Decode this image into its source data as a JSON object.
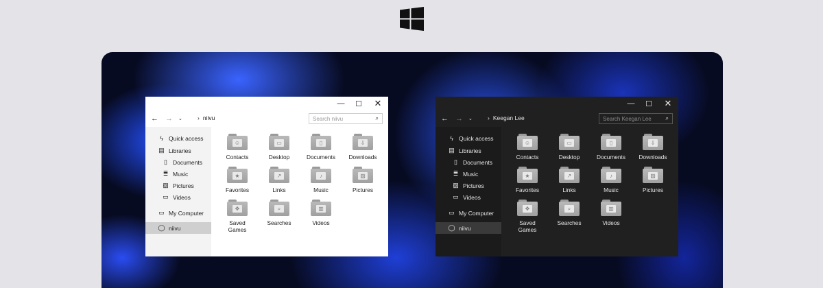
{
  "logo": {
    "icon": "windows-logo-icon"
  },
  "windows": [
    {
      "theme": "light",
      "controls": {
        "minimize": "—",
        "maximize": "☐",
        "close": "✕"
      },
      "nav": {
        "back": "←",
        "forward": "→",
        "recent": "⌄"
      },
      "breadcrumb": {
        "separator": "›",
        "location": "niivu"
      },
      "search": {
        "placeholder": "Search niivu",
        "icon": "⌕"
      },
      "sidebar": [
        {
          "label": "Quick access",
          "icon": "lightning-icon",
          "glyph": "ϟ"
        },
        {
          "label": "Libraries",
          "icon": "libraries-icon",
          "glyph": "▤"
        },
        {
          "label": "Documents",
          "icon": "document-icon",
          "glyph": "▯"
        },
        {
          "label": "Music",
          "icon": "music-icon",
          "glyph": "≣"
        },
        {
          "label": "Pictures",
          "icon": "pictures-icon",
          "glyph": "▨"
        },
        {
          "label": "Videos",
          "icon": "videos-icon",
          "glyph": "▭"
        },
        {
          "label": "My Computer",
          "icon": "computer-icon",
          "glyph": "▭"
        },
        {
          "label": "niivu",
          "icon": "user-icon",
          "glyph": "◯"
        }
      ],
      "folders": [
        {
          "label": "Contacts",
          "icon": "contacts-folder-icon",
          "glyph": "☺"
        },
        {
          "label": "Desktop",
          "icon": "desktop-folder-icon",
          "glyph": "▭"
        },
        {
          "label": "Documents",
          "icon": "documents-folder-icon",
          "glyph": "▯"
        },
        {
          "label": "Downloads",
          "icon": "downloads-folder-icon",
          "glyph": "⇩"
        },
        {
          "label": "Favorites",
          "icon": "favorites-folder-icon",
          "glyph": "★"
        },
        {
          "label": "Links",
          "icon": "links-folder-icon",
          "glyph": "↗"
        },
        {
          "label": "Music",
          "icon": "music-folder-icon",
          "glyph": "♪"
        },
        {
          "label": "Pictures",
          "icon": "pictures-folder-icon",
          "glyph": "▨"
        },
        {
          "label": "Saved Games",
          "icon": "saved-games-folder-icon",
          "glyph": "✥"
        },
        {
          "label": "Searches",
          "icon": "searches-folder-icon",
          "glyph": "⌕"
        },
        {
          "label": "Videos",
          "icon": "videos-folder-icon",
          "glyph": "▥"
        }
      ]
    },
    {
      "theme": "dark",
      "controls": {
        "minimize": "—",
        "maximize": "☐",
        "close": "✕"
      },
      "nav": {
        "back": "←",
        "forward": "→",
        "recent": "⌄"
      },
      "breadcrumb": {
        "separator": "›",
        "location": "Keegan Lee"
      },
      "search": {
        "placeholder": "Search Keegan Lee",
        "icon": "⌕"
      },
      "sidebar": [
        {
          "label": "Quick access",
          "icon": "lightning-icon",
          "glyph": "ϟ"
        },
        {
          "label": "Libraries",
          "icon": "libraries-icon",
          "glyph": "▤"
        },
        {
          "label": "Documents",
          "icon": "document-icon",
          "glyph": "▯"
        },
        {
          "label": "Music",
          "icon": "music-icon",
          "glyph": "≣"
        },
        {
          "label": "Pictures",
          "icon": "pictures-icon",
          "glyph": "▨"
        },
        {
          "label": "Videos",
          "icon": "videos-icon",
          "glyph": "▭"
        },
        {
          "label": "My Computer",
          "icon": "computer-icon",
          "glyph": "▭"
        },
        {
          "label": "niivu",
          "icon": "user-icon",
          "glyph": "◯"
        }
      ],
      "folders": [
        {
          "label": "Contacts",
          "icon": "contacts-folder-icon",
          "glyph": "☺"
        },
        {
          "label": "Desktop",
          "icon": "desktop-folder-icon",
          "glyph": "▭"
        },
        {
          "label": "Documents",
          "icon": "documents-folder-icon",
          "glyph": "▯"
        },
        {
          "label": "Downloads",
          "icon": "downloads-folder-icon",
          "glyph": "⇩"
        },
        {
          "label": "Favorites",
          "icon": "favorites-folder-icon",
          "glyph": "★"
        },
        {
          "label": "Links",
          "icon": "links-folder-icon",
          "glyph": "↗"
        },
        {
          "label": "Music",
          "icon": "music-folder-icon",
          "glyph": "♪"
        },
        {
          "label": "Pictures",
          "icon": "pictures-folder-icon",
          "glyph": "▨"
        },
        {
          "label": "Saved Games",
          "icon": "saved-games-folder-icon",
          "glyph": "✥"
        },
        {
          "label": "Searches",
          "icon": "searches-folder-icon",
          "glyph": "⌕"
        },
        {
          "label": "Videos",
          "icon": "videos-folder-icon",
          "glyph": "▥"
        }
      ]
    }
  ]
}
